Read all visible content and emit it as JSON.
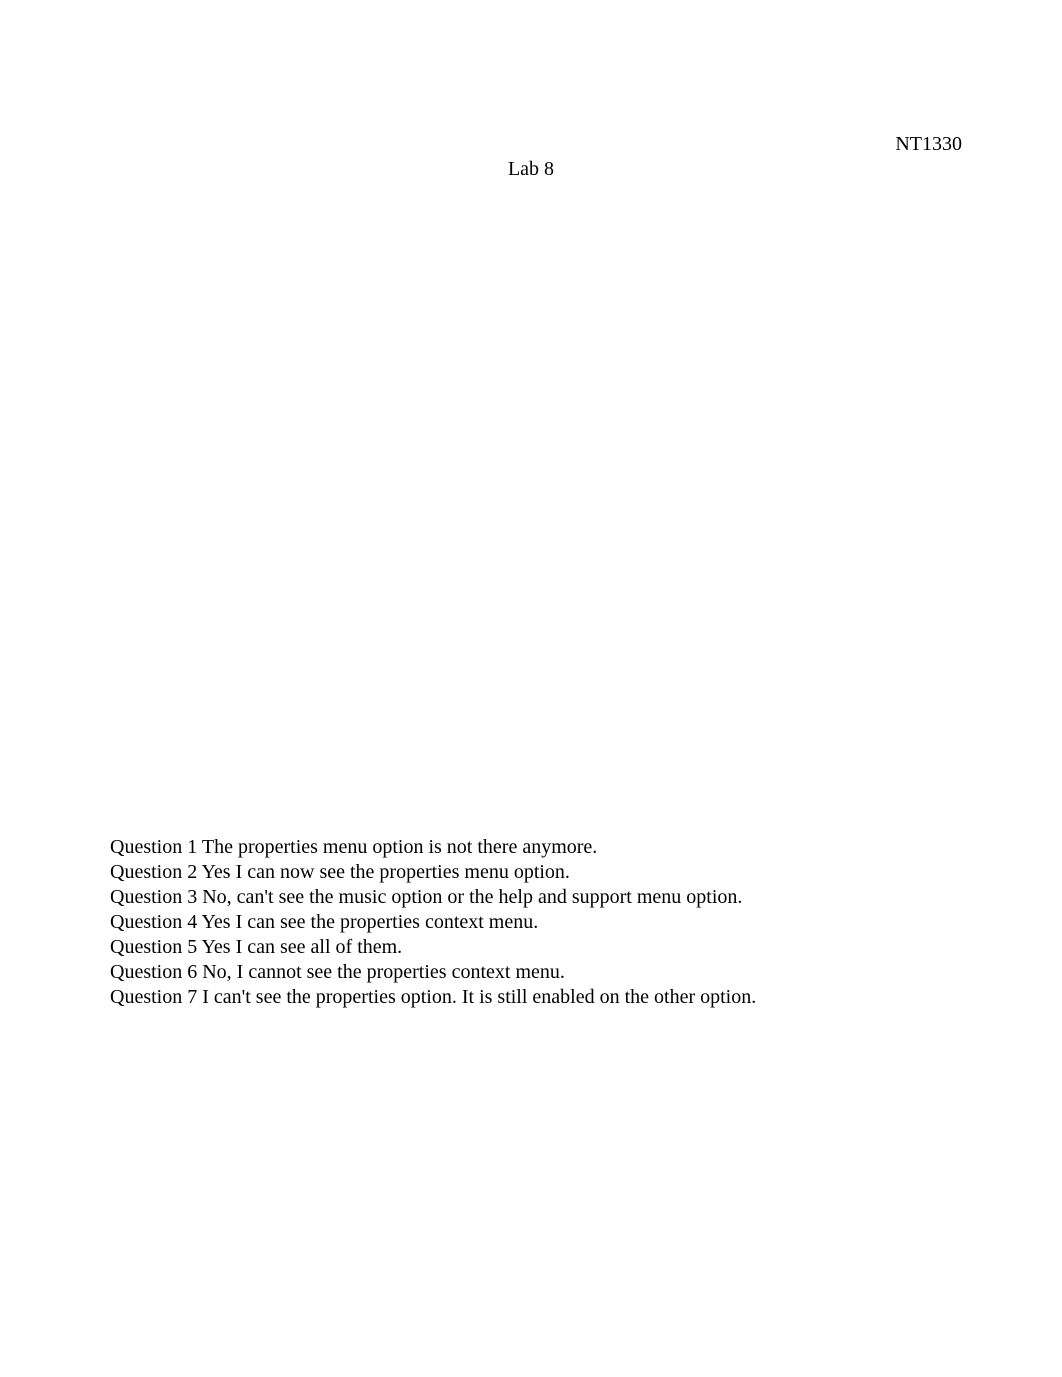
{
  "header": {
    "course_code": "NT1330",
    "title": "Lab 8"
  },
  "questions": [
    {
      "label": "Question 1",
      "text": "The properties menu option is not there anymore."
    },
    {
      "label": "Question 2",
      "text": "Yes I can now see the properties menu option."
    },
    {
      "label": "Question 3",
      "text": "No, can't see the music option or the help and support menu option."
    },
    {
      "label": "Question 4",
      "text": "Yes I can see the properties context menu."
    },
    {
      "label": "Question 5",
      "text": "Yes I can see all of them."
    },
    {
      "label": "Question 6",
      "text": "No, I cannot see the properties context menu."
    },
    {
      "label": "Question 7",
      "text": "I can't see the properties option. It is still enabled on the other option."
    }
  ]
}
